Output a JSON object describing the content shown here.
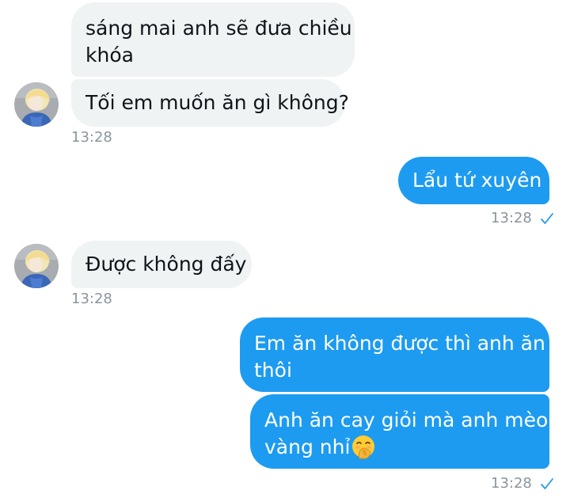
{
  "messages": [
    {
      "lines": [
        "sáng mai anh sẽ đưa chiều",
        "khóa"
      ]
    },
    {
      "lines": [
        "Tối em muốn ăn gì không?"
      ],
      "time": "13:28"
    },
    {
      "lines": [
        "Lẩu tứ xuyên"
      ],
      "time": "13:28"
    },
    {
      "lines": [
        "Được không đấy"
      ],
      "time": "13:28"
    },
    {
      "lines": [
        "Em ăn không được thì anh ăn",
        "thôi"
      ]
    },
    {
      "lines": [
        "Anh ăn cay giỏi mà anh mèo",
        "vàng nhỉ"
      ],
      "time": "13:28",
      "emoji": "hand-over-mouth-emoji"
    }
  ],
  "icons": {
    "read_receipt": "checkmark-icon",
    "avatar": "contact-avatar"
  },
  "colors": {
    "incoming_bubble": "#eff3f4",
    "outgoing_bubble": "#1d9bf0",
    "timestamp": "#8a959e",
    "check": "#1d9bf0"
  }
}
